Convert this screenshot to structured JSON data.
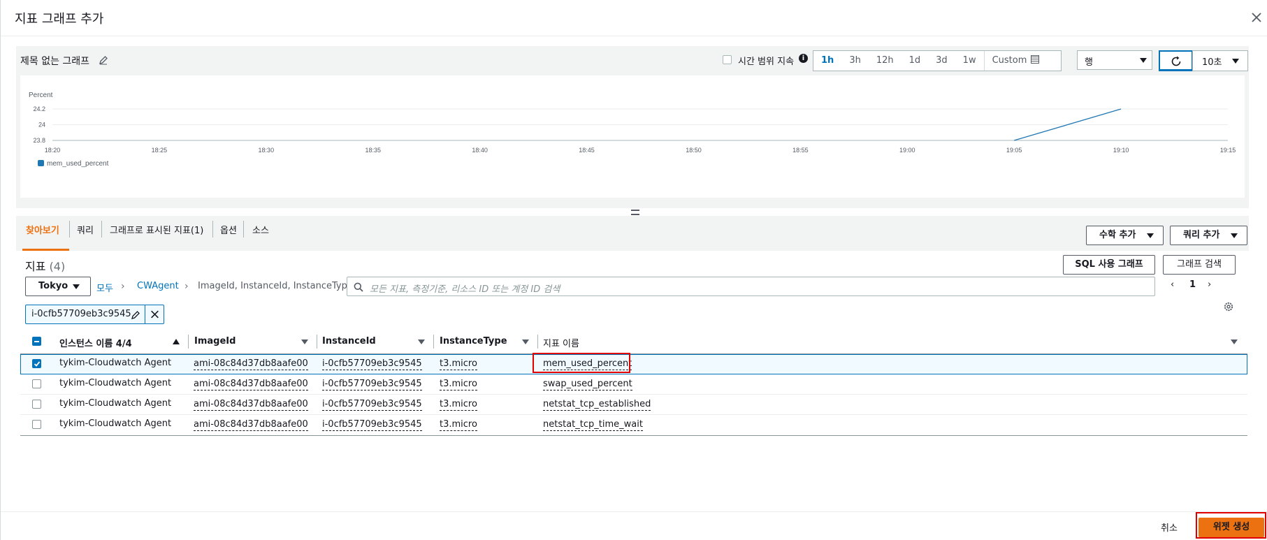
{
  "modal": {
    "title": "지표 그래프 추가",
    "close_icon": "close-icon"
  },
  "graph": {
    "title": "제목 없는 그래프",
    "time_sync_label": "시간 범위 지속",
    "time_ranges": [
      "1h",
      "3h",
      "12h",
      "1d",
      "3d",
      "1w",
      "Custom"
    ],
    "active_range": "1h",
    "chart_type": "행",
    "refresh_interval": "10초"
  },
  "chart_data": {
    "type": "line",
    "ylabel": "Percent",
    "yticks": [
      "24.2",
      "24",
      "23.8"
    ],
    "ylim": [
      23.8,
      24.2
    ],
    "xticks": [
      "18:20",
      "18:25",
      "18:30",
      "18:35",
      "18:40",
      "18:45",
      "18:50",
      "18:55",
      "19:00",
      "19:05",
      "19:10",
      "19:15"
    ],
    "series": [
      {
        "name": "mem_used_percent",
        "color": "#1f77b4",
        "points": [
          {
            "x": "19:05",
            "y": 23.8
          },
          {
            "x": "19:10",
            "y": 24.2
          }
        ]
      }
    ],
    "legend": "bottom-left",
    "grid": true
  },
  "tabs": [
    {
      "label": "찾아보기",
      "active": true
    },
    {
      "label": "쿼리",
      "active": false
    },
    {
      "label": "그래프로 표시된 지표(1)",
      "active": false
    },
    {
      "label": "옵션",
      "active": false
    },
    {
      "label": "소스",
      "active": false
    }
  ],
  "actions": {
    "add_math": "수학 추가",
    "add_query": "쿼리 추가",
    "sql_graph": "SQL 사용 그래프",
    "graph_search": "그래프 검색"
  },
  "metrics": {
    "title": "지표",
    "count": "(4)",
    "region": "Tokyo",
    "breadcrumb": [
      "모두",
      "CWAgent",
      "ImageId, InstanceId, InstanceType"
    ],
    "search_placeholder": "모든 지표, 측정기준, 리소스 ID 또는 계정 ID 검색",
    "page": "1",
    "filter_token": "i-0cfb57709eb3c9545",
    "columns": [
      "인스턴스 이름 4/4",
      "ImageId",
      "InstanceId",
      "InstanceType",
      "지표 이름"
    ],
    "rows": [
      {
        "checked": true,
        "name": "tykim-Cloudwatch Agent",
        "image": "ami-08c84d37db8aafe00",
        "instance": "i-0cfb57709eb3c9545",
        "type": "t3.micro",
        "metric": "mem_used_percent"
      },
      {
        "checked": false,
        "name": "tykim-Cloudwatch Agent",
        "image": "ami-08c84d37db8aafe00",
        "instance": "i-0cfb57709eb3c9545",
        "type": "t3.micro",
        "metric": "swap_used_percent"
      },
      {
        "checked": false,
        "name": "tykim-Cloudwatch Agent",
        "image": "ami-08c84d37db8aafe00",
        "instance": "i-0cfb57709eb3c9545",
        "type": "t3.micro",
        "metric": "netstat_tcp_established"
      },
      {
        "checked": false,
        "name": "tykim-Cloudwatch Agent",
        "image": "ami-08c84d37db8aafe00",
        "instance": "i-0cfb57709eb3c9545",
        "type": "t3.micro",
        "metric": "netstat_tcp_time_wait"
      }
    ]
  },
  "footer": {
    "cancel": "취소",
    "create": "위젯 생성"
  },
  "colors": {
    "accent_orange": "#ec7211",
    "link_blue": "#0073bb",
    "highlight_red": "#e00000"
  }
}
